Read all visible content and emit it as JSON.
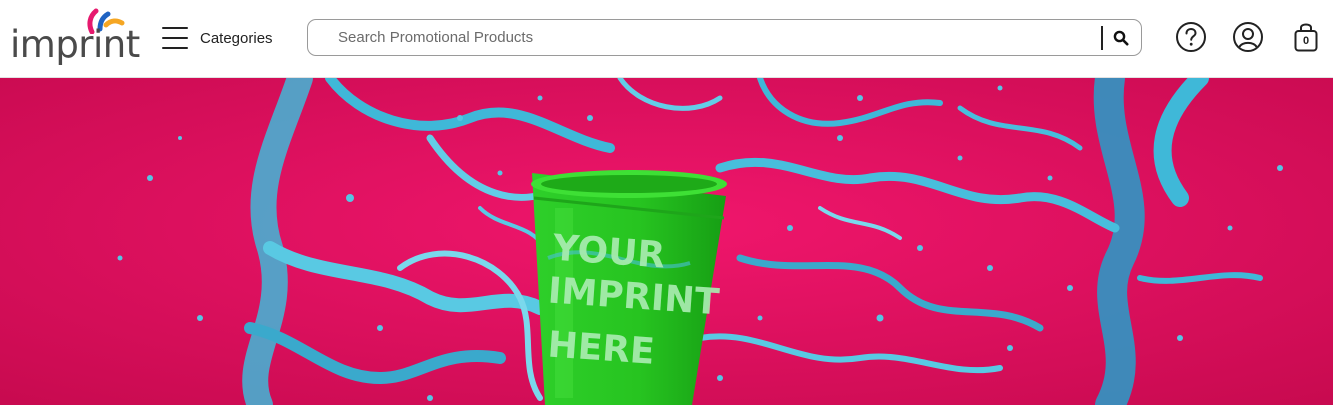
{
  "brand": {
    "name": "imprint",
    "logo_colors": [
      "#e6196e",
      "#1f63c2",
      "#f5a623"
    ]
  },
  "nav": {
    "categories_label": "Categories"
  },
  "search": {
    "placeholder": "Search Promotional Products",
    "value": ""
  },
  "header_icons": [
    "help-icon",
    "account-icon",
    "cart-icon"
  ],
  "cart": {
    "count": "0"
  },
  "hero": {
    "cup_text": [
      "YOUR",
      "IMPRINT",
      "HERE"
    ],
    "colors": {
      "background": "#e3105f",
      "splash": "#3fb8d8",
      "cup": "#25c41f"
    }
  }
}
